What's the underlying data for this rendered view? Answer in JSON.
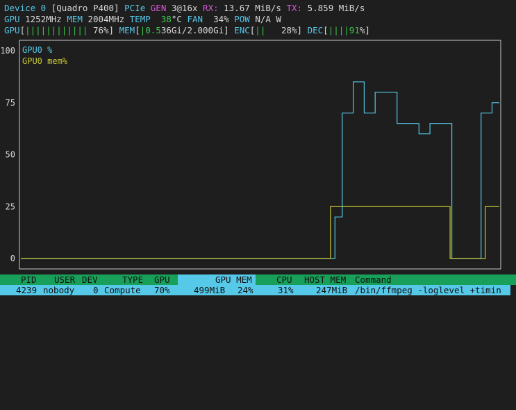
{
  "header": {
    "line1": {
      "device": "Device 0",
      "gpu_name": "[Quadro P400]",
      "pcie_label": "PCIe",
      "gen_label": "GEN",
      "gen_value": "3@16x",
      "rx_label": "RX:",
      "rx_value": "13.67 MiB/s",
      "tx_label": "TX:",
      "tx_value": "5.859 MiB/s"
    },
    "line2": {
      "gpu_label": "GPU",
      "gpu_clock": "1252MHz",
      "mem_label": "MEM",
      "mem_clock": "2004MHz",
      "temp_label": "TEMP",
      "temp_value": "38",
      "temp_unit": "°C",
      "fan_label": "FAN",
      "fan_value": "34%",
      "pow_label": "POW",
      "pow_value": "N/A W"
    },
    "line3": {
      "gpu_label": "GPU",
      "gpu_bars": "||||||||||||",
      "gpu_pct": "76%",
      "mem_label": "MEM",
      "mem_value_hl": "0.5",
      "mem_value_rest": "36Gi/2.000Gi",
      "enc_label": "ENC",
      "enc_bars": "||",
      "enc_pct": "28%",
      "dec_label": "DEC",
      "dec_bars": "||||",
      "dec_value_hl": "91",
      "dec_pct_sign": "%"
    }
  },
  "colors": {
    "background": "#1e1e1e",
    "cyan": "#56c8e8",
    "green": "#3ec84a",
    "yellow": "#c8c832",
    "magenta": "#d65ad6",
    "header_green": "#18a05a"
  },
  "chart_data": {
    "type": "line",
    "ylim": [
      0,
      100
    ],
    "yticks": [
      "100",
      "75",
      "50",
      "25",
      "0"
    ],
    "series": [
      {
        "name": "GPU0 %",
        "color": "#56c8e8",
        "values": [
          0,
          0,
          0,
          0,
          0,
          0,
          0,
          0,
          0,
          0,
          0,
          0,
          0,
          0,
          0,
          0,
          0,
          0,
          0,
          0,
          0,
          0,
          0,
          0,
          0,
          0,
          0,
          0,
          0,
          0,
          0,
          0,
          0,
          0,
          0,
          0,
          0,
          0,
          0,
          0,
          0,
          0,
          0,
          0,
          0,
          0,
          0,
          0,
          0,
          0,
          0,
          0,
          0,
          0,
          0,
          0,
          0,
          0,
          0,
          0,
          0,
          0,
          0,
          0,
          0,
          0,
          0,
          0,
          0,
          0,
          0,
          0,
          0,
          0,
          0,
          0,
          0,
          0,
          0,
          0,
          0,
          0,
          0,
          0,
          0,
          0,
          20,
          20,
          70,
          70,
          70,
          85,
          85,
          85,
          70,
          70,
          70,
          80,
          80,
          80,
          80,
          80,
          80,
          65,
          65,
          65,
          65,
          65,
          65,
          60,
          60,
          60,
          65,
          65,
          65,
          65,
          65,
          65,
          0,
          0,
          0,
          0,
          0,
          0,
          0,
          0,
          70,
          70,
          70,
          75,
          75
        ]
      },
      {
        "name": "GPU0 mem%",
        "color": "#c8c832",
        "values": [
          0,
          0,
          0,
          0,
          0,
          0,
          0,
          0,
          0,
          0,
          0,
          0,
          0,
          0,
          0,
          0,
          0,
          0,
          0,
          0,
          0,
          0,
          0,
          0,
          0,
          0,
          0,
          0,
          0,
          0,
          0,
          0,
          0,
          0,
          0,
          0,
          0,
          0,
          0,
          0,
          0,
          0,
          0,
          0,
          0,
          0,
          0,
          0,
          0,
          0,
          0,
          0,
          0,
          0,
          0,
          0,
          0,
          0,
          0,
          0,
          0,
          0,
          0,
          0,
          0,
          0,
          0,
          0,
          0,
          0,
          0,
          0,
          0,
          0,
          0,
          0,
          0,
          0,
          0,
          0,
          0,
          0,
          0,
          0,
          0,
          0,
          0,
          0,
          25,
          25,
          25,
          25,
          25,
          25,
          25,
          25,
          25,
          25,
          25,
          25,
          25,
          25,
          25,
          25,
          25,
          25,
          25,
          25,
          25,
          25,
          25,
          25,
          25,
          25,
          25,
          25,
          25,
          25,
          25,
          25,
          25,
          25,
          0,
          0,
          0,
          0,
          0,
          0,
          0,
          0,
          0,
          0,
          25,
          25,
          25,
          25
        ]
      }
    ]
  },
  "process_table": {
    "headers": {
      "pid": "PID",
      "user": "USER",
      "dev": "DEV",
      "type": "TYPE",
      "gpu": "GPU",
      "gpu_mem": "GPU MEM",
      "cpu": "CPU",
      "host_mem": "HOST MEM",
      "command": "Command"
    },
    "rows": [
      {
        "pid": "4239",
        "user": "nobody",
        "dev": "0",
        "type": "Compute",
        "gpu": "70%",
        "gpu_mem_used": "499MiB",
        "gpu_mem_pct": "24%",
        "cpu": "31%",
        "host_mem": "247MiB",
        "command": "/bin/ffmpeg -loglevel +timin"
      }
    ]
  }
}
